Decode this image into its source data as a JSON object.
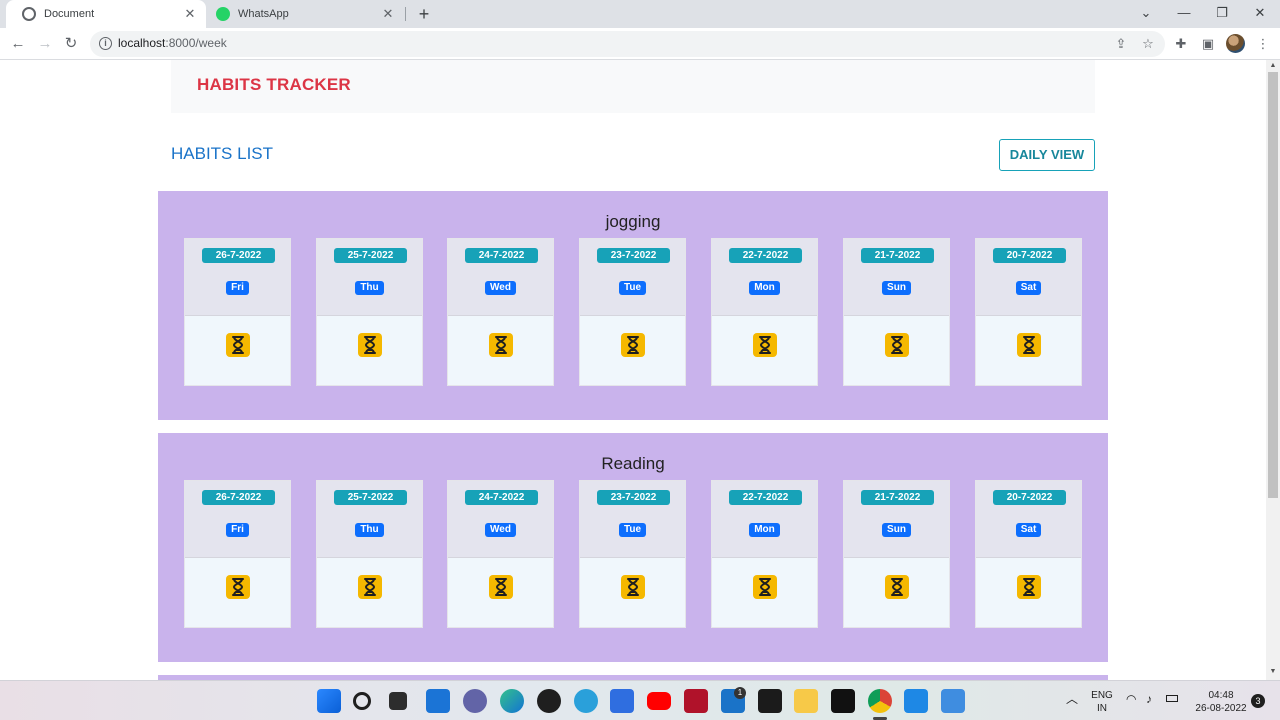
{
  "browser": {
    "tabs": [
      {
        "title": "Document",
        "active": true
      },
      {
        "title": "WhatsApp",
        "active": false
      }
    ],
    "url_host": "localhost",
    "url_path": ":8000/week"
  },
  "page": {
    "brand": "HABITS TRACKER",
    "list_title": "HABITS LIST",
    "daily_view_label": "DAILY VIEW"
  },
  "habits": [
    {
      "name": "jogging",
      "days": [
        {
          "date": "26-7-2022",
          "dow": "Fri"
        },
        {
          "date": "25-7-2022",
          "dow": "Thu"
        },
        {
          "date": "24-7-2022",
          "dow": "Wed"
        },
        {
          "date": "23-7-2022",
          "dow": "Tue"
        },
        {
          "date": "22-7-2022",
          "dow": "Mon"
        },
        {
          "date": "21-7-2022",
          "dow": "Sun"
        },
        {
          "date": "20-7-2022",
          "dow": "Sat"
        }
      ]
    },
    {
      "name": "Reading",
      "days": [
        {
          "date": "26-7-2022",
          "dow": "Fri"
        },
        {
          "date": "25-7-2022",
          "dow": "Thu"
        },
        {
          "date": "24-7-2022",
          "dow": "Wed"
        },
        {
          "date": "23-7-2022",
          "dow": "Tue"
        },
        {
          "date": "22-7-2022",
          "dow": "Mon"
        },
        {
          "date": "21-7-2022",
          "dow": "Sun"
        },
        {
          "date": "20-7-2022",
          "dow": "Sat"
        }
      ]
    }
  ],
  "status_icon": "hourglass-icon",
  "taskbar": {
    "lang_top": "ENG",
    "lang_bottom": "IN",
    "time": "04:48",
    "date": "26-08-2022",
    "notification_count": "3",
    "mail_badge": "1"
  },
  "colors": {
    "brand": "#dc3545",
    "habit_card": "#c9b3ec",
    "date_badge": "#17a2b8",
    "dow_badge": "#0d6efd",
    "pending_status": "#f5b800"
  }
}
